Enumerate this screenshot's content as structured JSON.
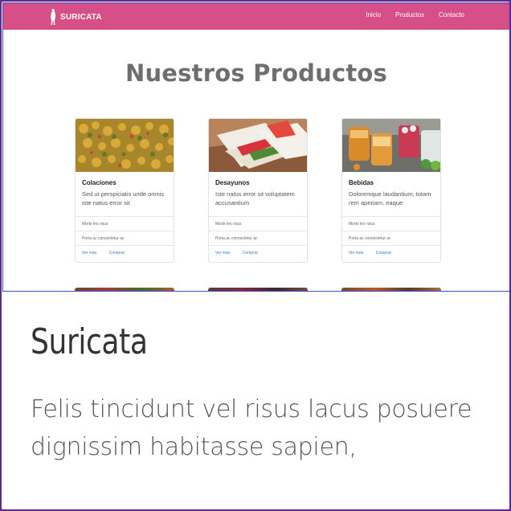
{
  "navbar": {
    "brand": "SURICATA",
    "links": [
      "Inicio",
      "Productos",
      "Contacto"
    ],
    "color": "#d64f86"
  },
  "section": {
    "title": "Nuestros Productos"
  },
  "products": [
    {
      "name": "Colaciones",
      "description": "Sed ut perspiciatis unde omnis iste natus error sit",
      "row1": "Morbi leo risus",
      "row2": "Porta ac consectetur ac",
      "link_more": "Ver más",
      "link_buy": "Comprar",
      "image": "chickpea-salad"
    },
    {
      "name": "Desayunos",
      "description": "Iste natus error sit voluptatem accusantium",
      "row1": "Morbi leo risus",
      "row2": "Porta ac consectetur ac",
      "link_more": "Ver más",
      "link_buy": "Comprar",
      "image": "sandwich"
    },
    {
      "name": "Bebidas",
      "description": "Doloremque laudantium, totam rem aperiam, eaque",
      "row1": "Morbi leo risus",
      "row2": "Porta ac consectetur ac",
      "link_more": "Ver más",
      "link_buy": "Comprar",
      "image": "drinks"
    }
  ],
  "content": {
    "title": "Suricata",
    "text": "Felis tincidunt vel risus lacus posuere dignissim habitasse sapien,"
  }
}
